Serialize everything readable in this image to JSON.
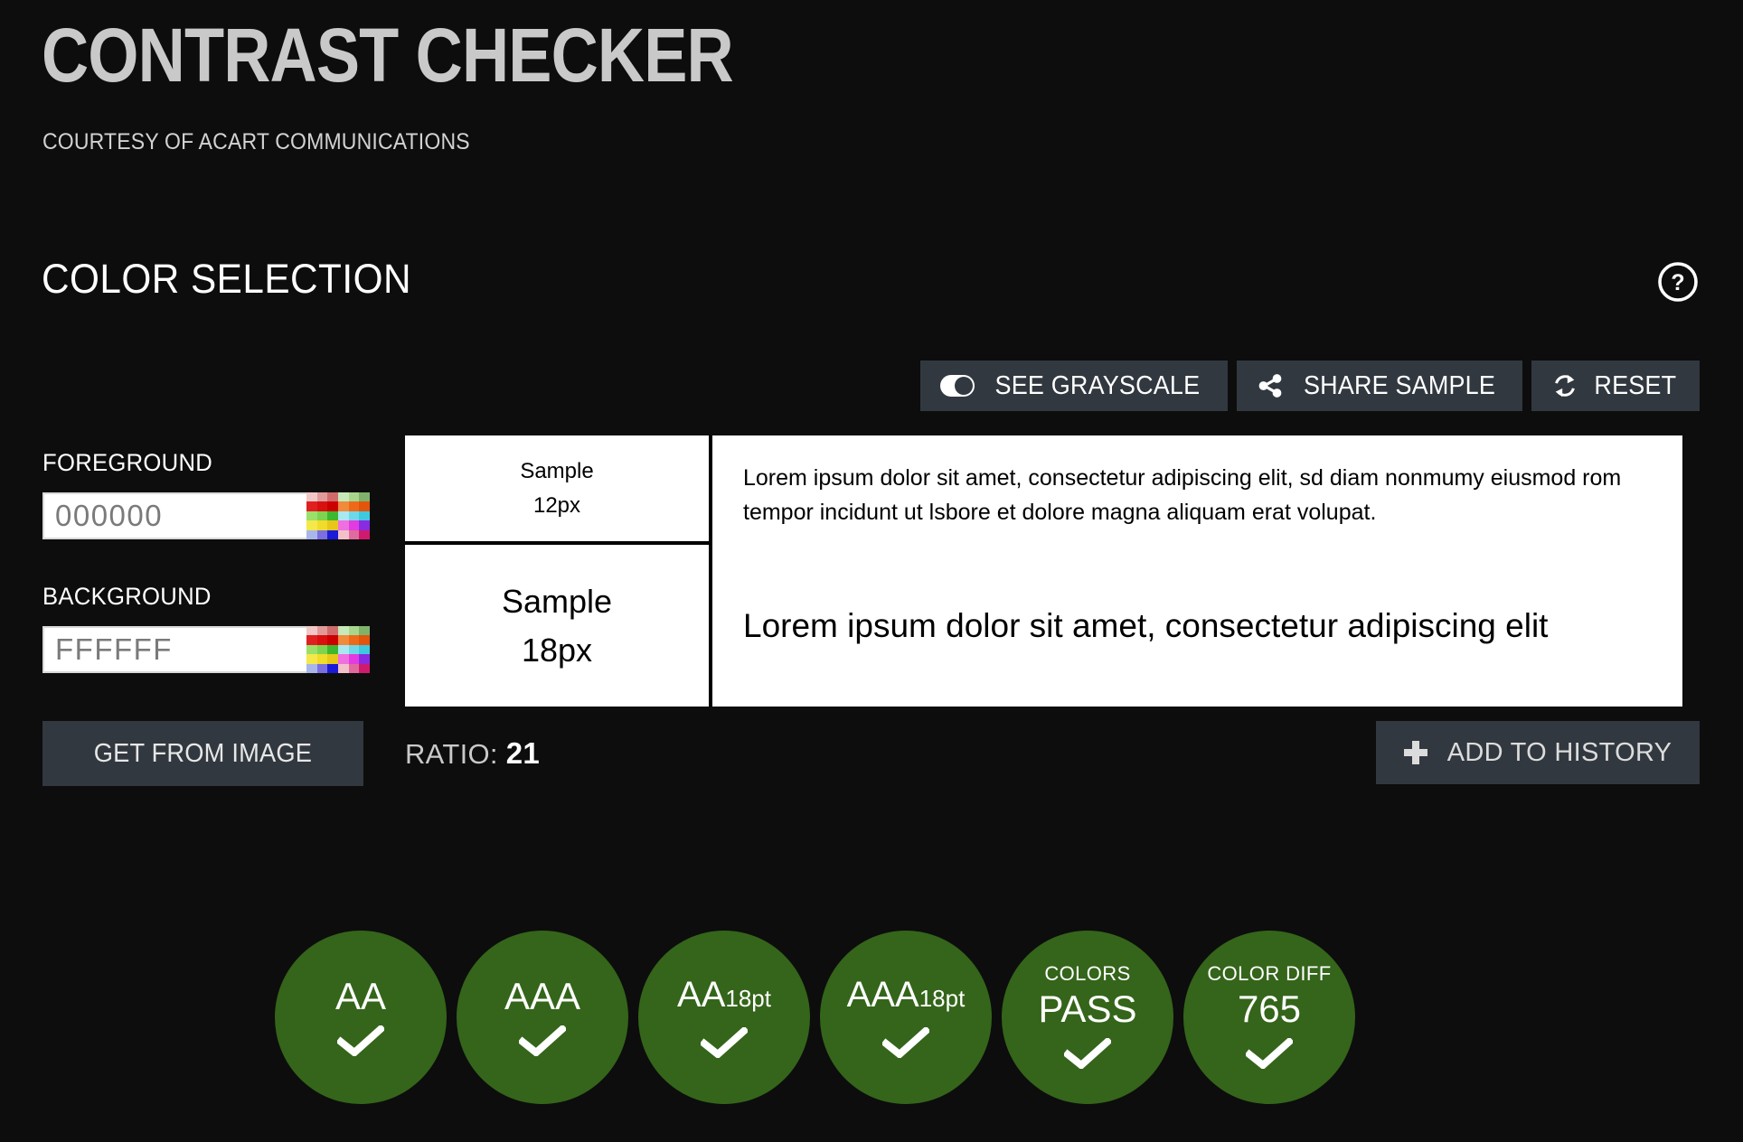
{
  "header": {
    "title": "CONTRAST CHECKER",
    "subtitle": "COURTESY OF ACART COMMUNICATIONS"
  },
  "section": {
    "title": "COLOR SELECTION",
    "help_icon": "help-circle-icon"
  },
  "toolbar": {
    "grayscale": {
      "label": "SEE GRAYSCALE",
      "icon": "contrast-toggle-icon"
    },
    "share": {
      "label": "SHARE SAMPLE",
      "icon": "share-icon"
    },
    "reset": {
      "label": "RESET",
      "icon": "refresh-icon"
    }
  },
  "colors": {
    "foreground": {
      "label": "FOREGROUND",
      "value": "000000",
      "placeholder": "000000"
    },
    "background": {
      "label": "BACKGROUND",
      "value": "FFFFFF",
      "placeholder": "FFFFFF"
    },
    "get_from_image_label": "GET FROM IMAGE",
    "palette": [
      "#f2c7c7",
      "#e09a9a",
      "#d06b6b",
      "#c7e8b8",
      "#a8d68d",
      "#7fb36b",
      "#e02020",
      "#d81010",
      "#cc0000",
      "#f08a3c",
      "#ee6a1a",
      "#e2550b",
      "#9ae06b",
      "#7ed44f",
      "#3eb82e",
      "#a9e8f0",
      "#6fd8e8",
      "#3ec9de",
      "#f5e84a",
      "#f0dc2a",
      "#e8c71a",
      "#ef6fe0",
      "#e23ce0",
      "#8a2be2",
      "#a9b6ea",
      "#7a6fe0",
      "#1a1ad8",
      "#f2c0c8",
      "#e06a9e",
      "#d01a6e",
      "#d8d8d8",
      "#8e8e8e",
      "#1a1a1a",
      "#3a1010",
      "#6b1a1a",
      "#b07818"
    ]
  },
  "samples": {
    "small": {
      "label_line1": "Sample",
      "label_line2": "12px",
      "text": "Lorem ipsum dolor sit amet, consectetur adipiscing elit, sd diam nonmumy eiusmod rom tempor incidunt ut lsbore et dolore magna aliquam erat volupat."
    },
    "large": {
      "label_line1": "Sample",
      "label_line2": "18px",
      "text": "Lorem ipsum dolor sit amet, consectetur adipiscing elit"
    }
  },
  "results": {
    "ratio_label": "RATIO:",
    "ratio_value": "21",
    "add_to_history_label": "ADD TO HISTORY",
    "badges": [
      {
        "sub": "",
        "main": "AA",
        "sup": "",
        "status": "pass"
      },
      {
        "sub": "",
        "main": "AAA",
        "sup": "",
        "status": "pass"
      },
      {
        "sub": "",
        "main": "AA",
        "sup": "18pt",
        "status": "pass"
      },
      {
        "sub": "",
        "main": "AAA",
        "sup": "18pt",
        "status": "pass"
      },
      {
        "sub": "COLORS",
        "main": "PASS",
        "sup": "",
        "status": "pass"
      },
      {
        "sub": "COLOR DIFF",
        "main": "765",
        "sup": "",
        "status": "pass"
      }
    ]
  },
  "theme": {
    "page_bg": "#0d0d0d",
    "button_bg": "#313840",
    "pass_green": "#34651a",
    "title_gray": "#c9c9c9"
  }
}
